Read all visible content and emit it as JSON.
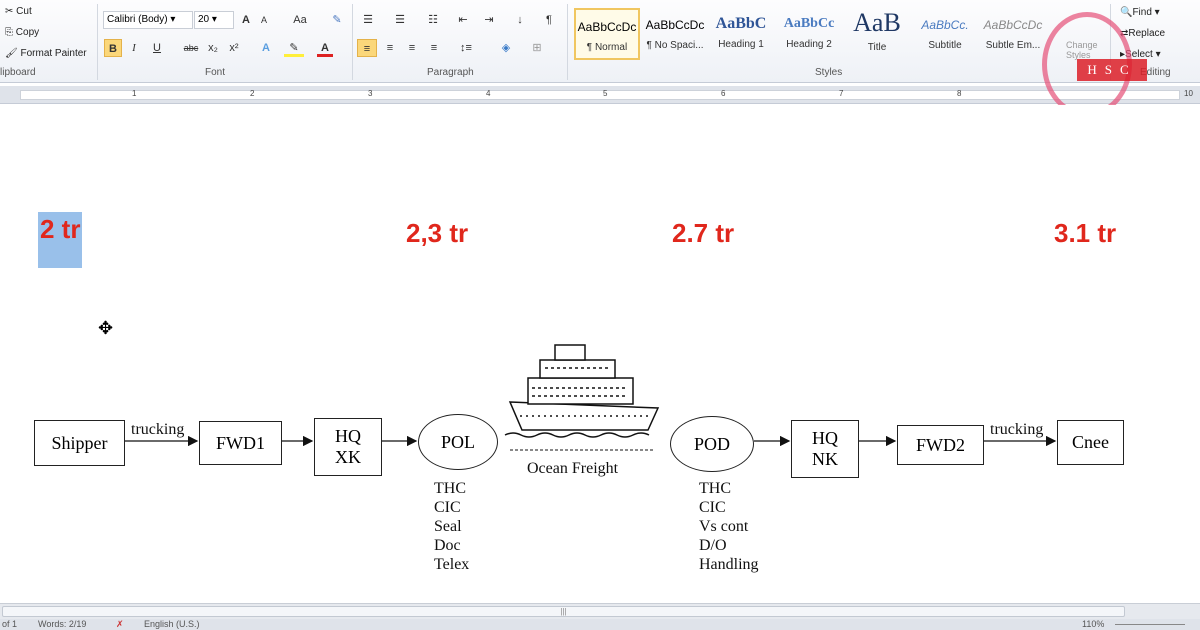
{
  "ribbon": {
    "clipboard": {
      "cut": "Cut",
      "copy": "Copy",
      "format_painter": "Format Painter",
      "label": "lipboard"
    },
    "font": {
      "name": "Calibri (Body)",
      "size": "20",
      "label": "Font",
      "bold": "B",
      "italic": "I",
      "underline": "U",
      "strike": "abc",
      "sub": "x₂",
      "sup": "x²",
      "grow": "A",
      "shrink": "A",
      "case": "Aa"
    },
    "paragraph": {
      "label": "Paragraph",
      "pilcrow": "¶"
    },
    "styles": {
      "label": "Styles",
      "items": [
        {
          "preview": "AaBbCcDc",
          "name": "¶ Normal"
        },
        {
          "preview": "AaBbCcDc",
          "name": "¶ No Spaci..."
        },
        {
          "preview": "AaBbC",
          "name": "Heading 1"
        },
        {
          "preview": "AaBbCc",
          "name": "Heading 2"
        },
        {
          "preview": "AaB",
          "name": "Title"
        },
        {
          "preview": "AaBbCc.",
          "name": "Subtitle"
        },
        {
          "preview": "AaBbCcDc",
          "name": "Subtle Em..."
        }
      ],
      "change_styles": "Change Styles"
    },
    "editing": {
      "find": "Find",
      "replace": "Replace",
      "select": "Select",
      "label": "Editing"
    }
  },
  "ruler": {
    "numbers": [
      "1",
      "2",
      "3",
      "4",
      "5",
      "6",
      "7",
      "8",
      "10"
    ]
  },
  "doc": {
    "prices": [
      "2 tr",
      "2,3 tr",
      "2.7 tr",
      "3.1 tr"
    ],
    "nodes": {
      "shipper": "Shipper",
      "fwd1": "FWD1",
      "hqxk": "HQ\nXK",
      "pol": "POL",
      "pod": "POD",
      "hqnk": "HQ\nNK",
      "fwd2": "FWD2",
      "cnee": "Cnee"
    },
    "trucking1": "trucking",
    "trucking2": "trucking",
    "ocean": "Ocean Freight",
    "pol_fees": [
      "THC",
      "CIC",
      "Seal",
      "Doc",
      "Telex"
    ],
    "pod_fees": [
      "THC",
      "CIC",
      "Vs cont",
      "D/O",
      "Handling"
    ]
  },
  "status": {
    "page": "of 1",
    "words": "Words: 2/19",
    "lang": "English (U.S.)",
    "zoom": "110%"
  },
  "watermark": "HSC",
  "colors": {
    "price": "#e0271c",
    "selection": "#99c0ea"
  }
}
